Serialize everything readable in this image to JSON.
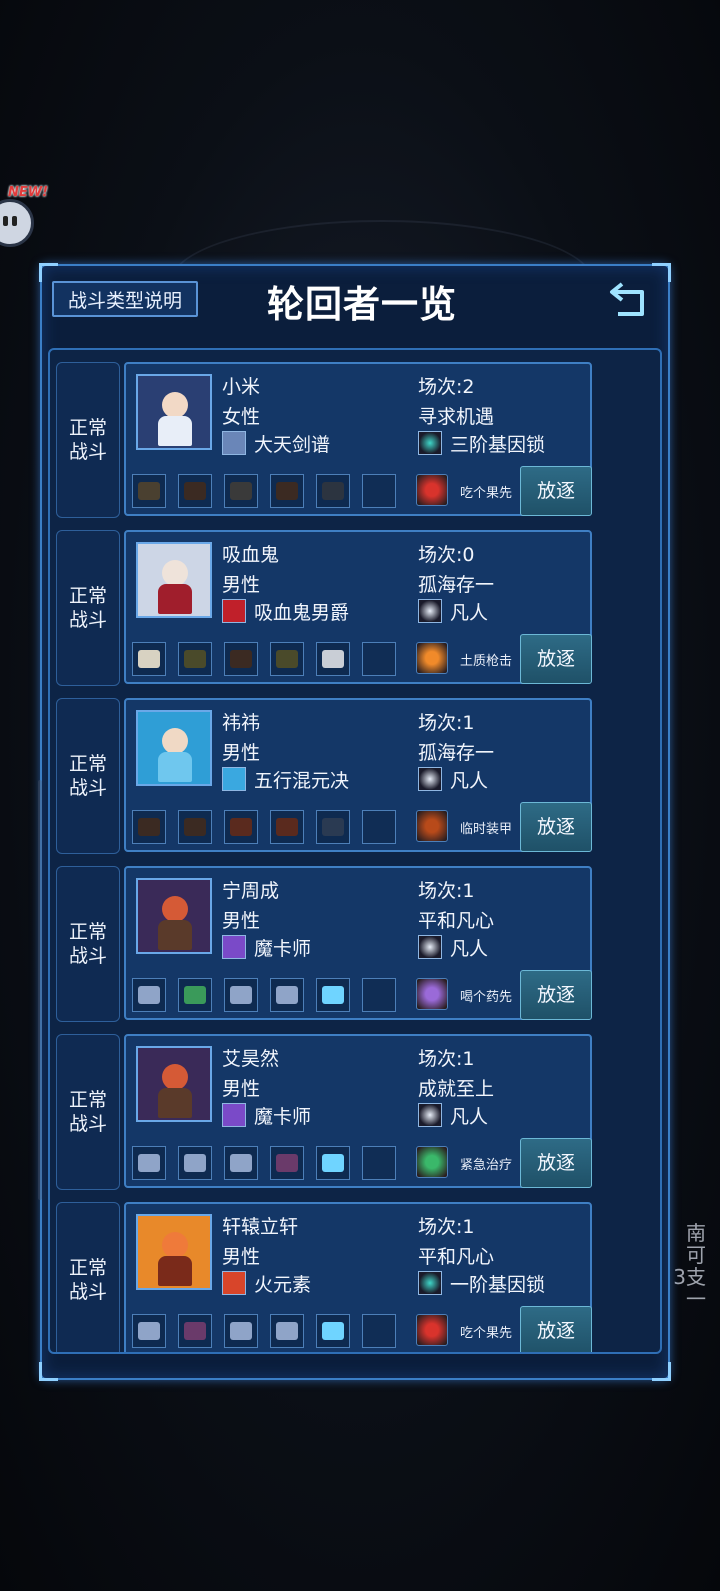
{
  "badge": {
    "new_label": "NEW!"
  },
  "side_hint": {
    "text": "南可\n3支\n一"
  },
  "panel": {
    "type_button_label": "战斗类型说明",
    "title": "轮回者一览",
    "expel_label": "放逐"
  },
  "rows": [
    {
      "battle": "正常战斗",
      "name": "小米",
      "gender": "女性",
      "skill": "大天剑谱",
      "count": "场次:2",
      "trait": "寻求机遇",
      "rank": "三阶基因锁",
      "consumable": "吃个果先",
      "skill_icon": "sword-manual-icon",
      "rank_icon": "gene-lock-icon",
      "consumable_icon": "fruit-icon",
      "portrait": {
        "bg": "#2a3f73",
        "head": "#f2d9c6",
        "torso": "#e8eef8"
      },
      "slots": [
        "armor",
        "glasses",
        "tool",
        "glasses",
        "gun",
        "empty"
      ]
    },
    {
      "battle": "正常战斗",
      "name": "吸血鬼",
      "gender": "男性",
      "skill": "吸血鬼男爵",
      "count": "场次:0",
      "trait": "孤海存一",
      "rank": "凡人",
      "consumable": "土质枪击",
      "skill_icon": "vampire-eye-icon",
      "rank_icon": "mortal-star-icon",
      "consumable_icon": "fireball-icon",
      "portrait": {
        "bg": "#cdd6e6",
        "head": "#efe3da",
        "torso": "#a01e2c"
      },
      "slots": [
        "shirt",
        "helmet",
        "glasses",
        "helmet",
        "pistol",
        "empty"
      ]
    },
    {
      "battle": "正常战斗",
      "name": "祎祎",
      "gender": "男性",
      "skill": "五行混元决",
      "count": "场次:1",
      "trait": "孤海存一",
      "rank": "凡人",
      "consumable": "临时装甲",
      "skill_icon": "vortex-icon",
      "rank_icon": "mortal-star-icon",
      "consumable_icon": "shield-ring-icon",
      "portrait": {
        "bg": "#2f9ed6",
        "head": "#f0d9c5",
        "torso": "#6fc7ee"
      },
      "slots": [
        "glasses",
        "glasses",
        "hat",
        "hat",
        "blade",
        "empty"
      ]
    },
    {
      "battle": "正常战斗",
      "name": "宁周成",
      "gender": "男性",
      "skill": "魔卡师",
      "count": "场次:1",
      "trait": "平和凡心",
      "rank": "凡人",
      "consumable": "喝个药先",
      "skill_icon": "magic-card-icon",
      "rank_icon": "mortal-star-icon",
      "consumable_icon": "potion-icon",
      "portrait": {
        "bg": "#3a2a58",
        "head": "#d55a36",
        "torso": "#5a3a2a"
      },
      "slots": [
        "crystal",
        "leaf",
        "crystal",
        "crystal",
        "ice-flower",
        "empty"
      ]
    },
    {
      "battle": "正常战斗",
      "name": "艾昊然",
      "gender": "男性",
      "skill": "魔卡师",
      "count": "场次:1",
      "trait": "成就至上",
      "rank": "凡人",
      "consumable": "紧急治疗",
      "skill_icon": "magic-card-icon",
      "rank_icon": "mortal-star-icon",
      "consumable_icon": "heal-cross-icon",
      "portrait": {
        "bg": "#3a2a58",
        "head": "#d55a36",
        "torso": "#5a3a2a"
      },
      "slots": [
        "crystal",
        "crystal",
        "crystal",
        "ore",
        "ice-flower",
        "empty"
      ]
    },
    {
      "battle": "正常战斗",
      "name": "轩辕立轩",
      "gender": "男性",
      "skill": "火元素",
      "count": "场次:1",
      "trait": "平和凡心",
      "rank": "一阶基因锁",
      "consumable": "吃个果先",
      "skill_icon": "fire-element-icon",
      "rank_icon": "gene-lock-icon",
      "consumable_icon": "fruit-icon",
      "portrait": {
        "bg": "#e8892a",
        "head": "#ef7a3a",
        "torso": "#7a2a1a"
      },
      "slots": [
        "crystal",
        "ore",
        "crystal",
        "crystal",
        "ice-flower",
        "empty"
      ]
    }
  ],
  "colors": {
    "panel_border": "#3b7fc7",
    "card_bg": "#143767",
    "expel_button": "#2e6b86",
    "accent": "#8fd0ff"
  }
}
